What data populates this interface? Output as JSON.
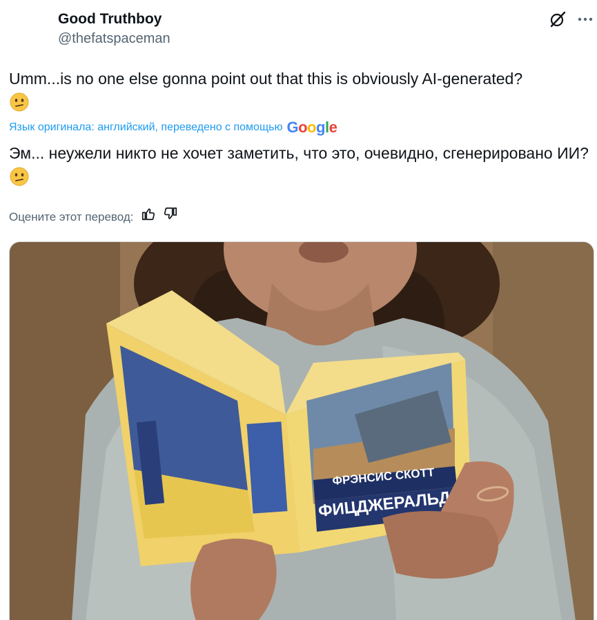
{
  "author": {
    "name": "Good Truthboy",
    "handle": "@thefatspaceman"
  },
  "tweet": {
    "original_text": "Umm...is no one else gonna point out that this is obviously AI-generated?",
    "translation_note": "Язык оригинала: английский, переведено с помощью",
    "translation_provider": "Google",
    "translated_text": "Эм... неужели никто не хочет заметить, что это, очевидно, сгенерировано ИИ?",
    "rate_label": "Оцените этот перевод:"
  },
  "media": {
    "book_author_line": "ФРЭНСИС СКОТТ",
    "book_title_line": "ФИЦДЖЕРАЛЬД"
  },
  "icons": [
    "grok-icon",
    "more-icon",
    "thumbs-up-icon",
    "thumbs-down-icon",
    "confused-face-emoji"
  ],
  "colors": {
    "link": "#1d9bf0",
    "secondary": "#536471"
  }
}
